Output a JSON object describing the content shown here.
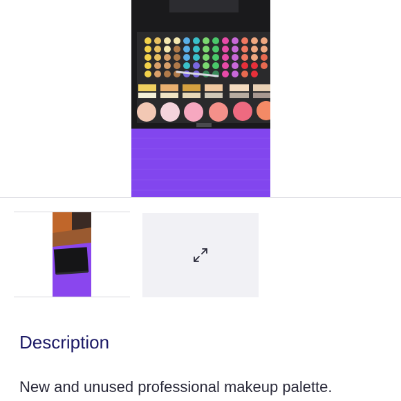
{
  "listing": {
    "main_image_alt": "Makeup palette with eyeshadows and blushes",
    "thumbnail_alt": "Closed black makeup palette case on purple surface"
  },
  "icons": {
    "expand": "expand-arrows-icon"
  },
  "description": {
    "heading": "Description",
    "text": "New and unused professional makeup palette."
  },
  "colors": {
    "heading": "#1c1a66",
    "tile_bg": "#f1f1f5",
    "backdrop": "#7a3ee6"
  }
}
